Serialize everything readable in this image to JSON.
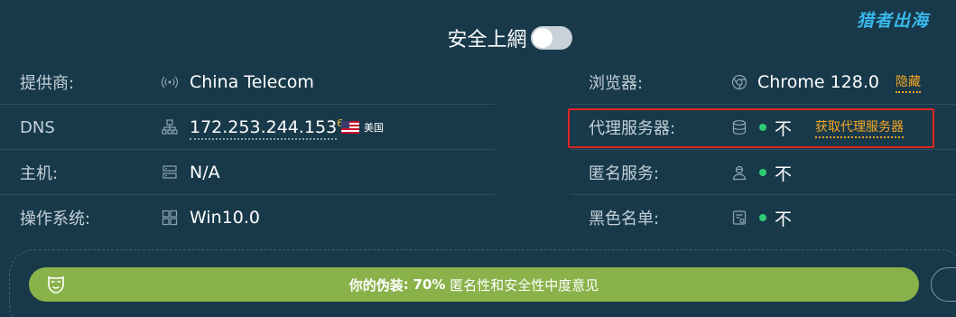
{
  "brand": "猎者出海",
  "topbar": {
    "safe_label": "安全上網"
  },
  "left_rows": [
    {
      "label": "提供商:",
      "icon": "signal-icon",
      "value": "China Telecom"
    },
    {
      "label": "DNS",
      "icon": "network-icon",
      "value": "172.253.244.153",
      "superscript": "6",
      "country": "美国"
    },
    {
      "label": "主机:",
      "icon": "server-icon",
      "value": "N/A"
    },
    {
      "label": "操作系统:",
      "icon": "windows-icon",
      "value": "Win10.0"
    }
  ],
  "right_rows": [
    {
      "label": "浏览器:",
      "icon": "chrome-icon",
      "value": "Chrome 128.0",
      "link": "隐藏"
    },
    {
      "label": "代理服务器:",
      "icon": "database-icon",
      "value": "不",
      "link": "获取代理服务器"
    },
    {
      "label": "匿名服务:",
      "icon": "anonymous-user-icon",
      "value": "不"
    },
    {
      "label": "黑色名单:",
      "icon": "blacklist-icon",
      "value": "不"
    }
  ],
  "disguise": {
    "prefix": "你的伪装",
    "colon": ":",
    "percent": "70%",
    "suffix": "匿名性和安全性中度意见"
  },
  "colors": {
    "background": "#18394a",
    "accent_green": "#8ab24a",
    "link_orange": "#f5a623",
    "status_green": "#2ecc71",
    "brand_blue": "#39b8ea",
    "highlight_red": "#e02424"
  }
}
